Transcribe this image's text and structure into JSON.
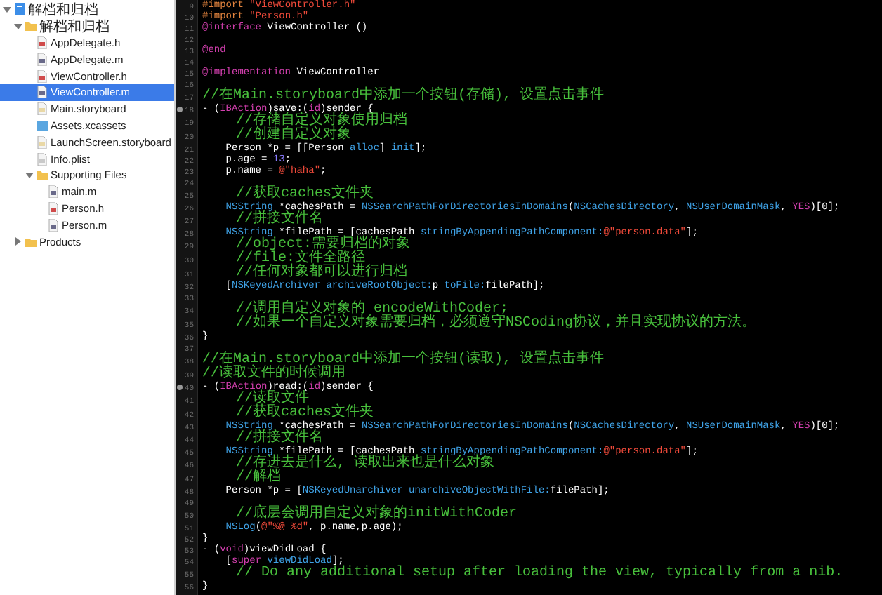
{
  "navigator": {
    "items": [
      {
        "label": "解档和归档",
        "kind": "project",
        "expanded": true,
        "selected": false,
        "children": [
          {
            "label": "解档和归档",
            "kind": "folder",
            "expanded": true,
            "selected": false,
            "children": [
              {
                "label": "AppDelegate.h",
                "kind": "header",
                "selected": false
              },
              {
                "label": "AppDelegate.m",
                "kind": "source",
                "selected": false
              },
              {
                "label": "ViewController.h",
                "kind": "header",
                "selected": false
              },
              {
                "label": "ViewController.m",
                "kind": "source",
                "selected": true
              },
              {
                "label": "Main.storyboard",
                "kind": "storyboard",
                "selected": false
              },
              {
                "label": "Assets.xcassets",
                "kind": "assets",
                "selected": false
              },
              {
                "label": "LaunchScreen.storyboard",
                "kind": "storyboard",
                "selected": false
              },
              {
                "label": "Info.plist",
                "kind": "plist",
                "selected": false
              },
              {
                "label": "Supporting Files",
                "kind": "folder",
                "expanded": true,
                "selected": false,
                "children": [
                  {
                    "label": "main.m",
                    "kind": "source",
                    "selected": false
                  },
                  {
                    "label": "Person.h",
                    "kind": "header",
                    "selected": false
                  },
                  {
                    "label": "Person.m",
                    "kind": "source",
                    "selected": false
                  }
                ]
              }
            ]
          },
          {
            "label": "Products",
            "kind": "folder",
            "expanded": false,
            "selected": false
          }
        ]
      }
    ]
  },
  "editor": {
    "lines": [
      {
        "number": "9",
        "connected": false,
        "tokens": [
          {
            "kind": "directive",
            "text": "#import "
          },
          {
            "kind": "string",
            "text": "\"ViewController.h\""
          }
        ]
      },
      {
        "number": "10",
        "connected": false,
        "tokens": [
          {
            "kind": "directive",
            "text": "#import "
          },
          {
            "kind": "string",
            "text": "\"Person.h\""
          }
        ]
      },
      {
        "number": "11",
        "connected": false,
        "tokens": [
          {
            "kind": "keyword",
            "text": "@interface"
          },
          {
            "kind": "plain",
            "text": " ViewController ()"
          }
        ]
      },
      {
        "number": "12",
        "connected": false
      },
      {
        "number": "13",
        "connected": false,
        "tokens": [
          {
            "kind": "keyword",
            "text": "@end"
          }
        ]
      },
      {
        "number": "14",
        "connected": false
      },
      {
        "number": "15",
        "connected": false,
        "tokens": [
          {
            "kind": "keyword",
            "text": "@implementation"
          },
          {
            "kind": "plain",
            "text": " ViewController"
          }
        ]
      },
      {
        "number": "16",
        "connected": false
      },
      {
        "number": "17",
        "connected": false,
        "tokens": [
          {
            "kind": "comment",
            "text": "//在Main.storyboard中添加一个按钮(存储), 设置点击事件"
          }
        ]
      },
      {
        "number": "18",
        "connected": true,
        "tokens": [
          {
            "kind": "plain",
            "text": "- ("
          },
          {
            "kind": "keyword",
            "text": "IBAction"
          },
          {
            "kind": "plain",
            "text": ")save:("
          },
          {
            "kind": "keyword",
            "text": "id"
          },
          {
            "kind": "plain",
            "text": ")sender {"
          }
        ]
      },
      {
        "number": "19",
        "connected": false,
        "tokens": [
          {
            "kind": "comment",
            "text": "    //存储自定义对象使用归档"
          }
        ]
      },
      {
        "number": "20",
        "connected": false,
        "tokens": [
          {
            "kind": "comment",
            "text": "    //创建自定义对象"
          }
        ]
      },
      {
        "number": "21",
        "connected": false,
        "tokens": [
          {
            "kind": "plain",
            "text": "    Person *p = [[Person "
          },
          {
            "kind": "type",
            "text": "alloc"
          },
          {
            "kind": "plain",
            "text": "] "
          },
          {
            "kind": "type",
            "text": "init"
          },
          {
            "kind": "plain",
            "text": "];"
          }
        ]
      },
      {
        "number": "22",
        "connected": false,
        "tokens": [
          {
            "kind": "plain",
            "text": "    p.age = "
          },
          {
            "kind": "number",
            "text": "13"
          },
          {
            "kind": "plain",
            "text": ";"
          }
        ]
      },
      {
        "number": "23",
        "connected": false,
        "tokens": [
          {
            "kind": "plain",
            "text": "    p.name = "
          },
          {
            "kind": "string",
            "text": "@\"haha\""
          },
          {
            "kind": "plain",
            "text": ";"
          }
        ]
      },
      {
        "number": "24",
        "connected": false
      },
      {
        "number": "25",
        "connected": false,
        "tokens": [
          {
            "kind": "comment",
            "text": "    //获取caches文件夹"
          }
        ]
      },
      {
        "number": "26",
        "connected": false,
        "tokens": [
          {
            "kind": "type",
            "text": "    NSString"
          },
          {
            "kind": "plain",
            "text": " *cachesPath = "
          },
          {
            "kind": "type",
            "text": "NSSearchPathForDirectoriesInDomains"
          },
          {
            "kind": "plain",
            "text": "("
          },
          {
            "kind": "type",
            "text": "NSCachesDirectory"
          },
          {
            "kind": "plain",
            "text": ", "
          },
          {
            "kind": "type",
            "text": "NSUserDomainMask"
          },
          {
            "kind": "plain",
            "text": ", "
          },
          {
            "kind": "keyword",
            "text": "YES"
          },
          {
            "kind": "plain",
            "text": ")[0];"
          }
        ]
      },
      {
        "number": "27",
        "connected": false,
        "tokens": [
          {
            "kind": "comment",
            "text": "    //拼接文件名"
          }
        ]
      },
      {
        "number": "28",
        "connected": false,
        "tokens": [
          {
            "kind": "type",
            "text": "    NSString"
          },
          {
            "kind": "plain",
            "text": " *filePath = [cachesPath "
          },
          {
            "kind": "type",
            "text": "stringByAppendingPathComponent:"
          },
          {
            "kind": "string",
            "text": "@\"person.data\""
          },
          {
            "kind": "plain",
            "text": "];"
          }
        ]
      },
      {
        "number": "29",
        "connected": false,
        "tokens": [
          {
            "kind": "comment",
            "text": "    //object:需要归档的对象"
          }
        ]
      },
      {
        "number": "30",
        "connected": false,
        "tokens": [
          {
            "kind": "comment",
            "text": "    //file:文件全路径"
          }
        ]
      },
      {
        "number": "31",
        "connected": false,
        "tokens": [
          {
            "kind": "comment",
            "text": "    //任何对象都可以进行归档"
          }
        ]
      },
      {
        "number": "32",
        "connected": false,
        "tokens": [
          {
            "kind": "plain",
            "text": "    ["
          },
          {
            "kind": "type",
            "text": "NSKeyedArchiver archiveRootObject:"
          },
          {
            "kind": "plain",
            "text": "p "
          },
          {
            "kind": "type",
            "text": "toFile:"
          },
          {
            "kind": "plain",
            "text": "filePath];"
          }
        ]
      },
      {
        "number": "33",
        "connected": false
      },
      {
        "number": "34",
        "connected": false,
        "tokens": [
          {
            "kind": "comment",
            "text": "    //调用自定义对象的 encodeWithCoder;"
          }
        ]
      },
      {
        "number": "35",
        "connected": false,
        "tokens": [
          {
            "kind": "comment",
            "text": "    //如果一个自定义对象需要归档，必须遵守NSCoding协议，并且实现协议的方法。"
          }
        ]
      },
      {
        "number": "36",
        "connected": false,
        "tokens": [
          {
            "kind": "plain",
            "text": "}"
          }
        ]
      },
      {
        "number": "37",
        "connected": false
      },
      {
        "number": "38",
        "connected": false,
        "tokens": [
          {
            "kind": "comment",
            "text": "//在Main.storyboard中添加一个按钮(读取), 设置点击事件"
          }
        ]
      },
      {
        "number": "39",
        "connected": false,
        "tokens": [
          {
            "kind": "comment",
            "text": "//读取文件的时候调用"
          }
        ]
      },
      {
        "number": "40",
        "connected": true,
        "tokens": [
          {
            "kind": "plain",
            "text": "- ("
          },
          {
            "kind": "keyword",
            "text": "IBAction"
          },
          {
            "kind": "plain",
            "text": ")read:("
          },
          {
            "kind": "keyword",
            "text": "id"
          },
          {
            "kind": "plain",
            "text": ")sender {"
          }
        ]
      },
      {
        "number": "41",
        "connected": false,
        "tokens": [
          {
            "kind": "comment",
            "text": "    //读取文件"
          }
        ]
      },
      {
        "number": "42",
        "connected": false,
        "tokens": [
          {
            "kind": "comment",
            "text": "    //获取caches文件夹"
          }
        ]
      },
      {
        "number": "43",
        "connected": false,
        "tokens": [
          {
            "kind": "type",
            "text": "    NSString"
          },
          {
            "kind": "plain",
            "text": " *cachesPath = "
          },
          {
            "kind": "type",
            "text": "NSSearchPathForDirectoriesInDomains"
          },
          {
            "kind": "plain",
            "text": "("
          },
          {
            "kind": "type",
            "text": "NSCachesDirectory"
          },
          {
            "kind": "plain",
            "text": ", "
          },
          {
            "kind": "type",
            "text": "NSUserDomainMask"
          },
          {
            "kind": "plain",
            "text": ", "
          },
          {
            "kind": "keyword",
            "text": "YES"
          },
          {
            "kind": "plain",
            "text": ")[0];"
          }
        ]
      },
      {
        "number": "44",
        "connected": false,
        "tokens": [
          {
            "kind": "comment",
            "text": "    //拼接文件名"
          }
        ]
      },
      {
        "number": "45",
        "connected": false,
        "tokens": [
          {
            "kind": "type",
            "text": "    NSString"
          },
          {
            "kind": "plain",
            "text": " *filePath = [cachesPath "
          },
          {
            "kind": "type",
            "text": "stringByAppendingPathComponent:"
          },
          {
            "kind": "string",
            "text": "@\"person.data\""
          },
          {
            "kind": "plain",
            "text": "];"
          }
        ]
      },
      {
        "number": "46",
        "connected": false,
        "tokens": [
          {
            "kind": "comment",
            "text": "    //存进去是什么, 读取出来也是什么对象"
          }
        ]
      },
      {
        "number": "47",
        "connected": false,
        "tokens": [
          {
            "kind": "comment",
            "text": "    //解档"
          }
        ]
      },
      {
        "number": "48",
        "connected": false,
        "tokens": [
          {
            "kind": "plain",
            "text": "    Person *p = ["
          },
          {
            "kind": "type",
            "text": "NSKeyedUnarchiver unarchiveObjectWithFile:"
          },
          {
            "kind": "plain",
            "text": "filePath];"
          }
        ]
      },
      {
        "number": "49",
        "connected": false
      },
      {
        "number": "50",
        "connected": false,
        "tokens": [
          {
            "kind": "comment",
            "text": "    //底层会调用自定义对象的initWithCoder"
          }
        ]
      },
      {
        "number": "51",
        "connected": false,
        "tokens": [
          {
            "kind": "type",
            "text": "    NSLog"
          },
          {
            "kind": "plain",
            "text": "("
          },
          {
            "kind": "string",
            "text": "@\"%@ %d\""
          },
          {
            "kind": "plain",
            "text": ", p.name,p.age);"
          }
        ]
      },
      {
        "number": "52",
        "connected": false,
        "tokens": [
          {
            "kind": "plain",
            "text": "}"
          }
        ]
      },
      {
        "number": "53",
        "connected": false,
        "tokens": [
          {
            "kind": "plain",
            "text": "- ("
          },
          {
            "kind": "keyword",
            "text": "void"
          },
          {
            "kind": "plain",
            "text": ")viewDidLoad {"
          }
        ]
      },
      {
        "number": "54",
        "connected": false,
        "tokens": [
          {
            "kind": "plain",
            "text": "    ["
          },
          {
            "kind": "keyword",
            "text": "super"
          },
          {
            "kind": "type",
            "text": " viewDidLoad"
          },
          {
            "kind": "plain",
            "text": "];"
          }
        ]
      },
      {
        "number": "55",
        "connected": false,
        "tokens": [
          {
            "kind": "comment",
            "text": "    // Do any additional setup after loading the view, typically from a nib."
          }
        ]
      },
      {
        "number": "56",
        "connected": false,
        "tokens": [
          {
            "kind": "plain",
            "text": "}"
          }
        ]
      }
    ]
  }
}
